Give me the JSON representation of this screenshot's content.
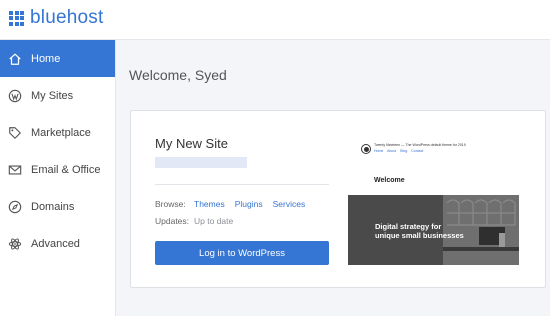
{
  "brand": {
    "name": "bluehost",
    "color": "#3575d3"
  },
  "sidebar": {
    "items": [
      {
        "label": "Home",
        "icon": "home-icon",
        "active": true
      },
      {
        "label": "My Sites",
        "icon": "wordpress-icon",
        "active": false
      },
      {
        "label": "Marketplace",
        "icon": "tag-icon",
        "active": false
      },
      {
        "label": "Email & Office",
        "icon": "envelope-icon",
        "active": false
      },
      {
        "label": "Domains",
        "icon": "compass-icon",
        "active": false
      },
      {
        "label": "Advanced",
        "icon": "atom-icon",
        "active": false
      }
    ]
  },
  "main": {
    "welcome": "Welcome, Syed",
    "site": {
      "name": "My New Site",
      "browse_label": "Browse:",
      "browse_links": [
        "Themes",
        "Plugins",
        "Services"
      ],
      "updates_label": "Updates:",
      "updates_value": "Up to date",
      "login_button": "Log in to WordPress",
      "preview": {
        "site_title": "Twenty Nineteen — The WordPress default theme for 2019",
        "nav": [
          "Home",
          "About",
          "Blog",
          "Contact"
        ],
        "welcome": "Welcome",
        "hero_line1": "Digital strategy for",
        "hero_line2": "unique small businesses"
      }
    }
  }
}
